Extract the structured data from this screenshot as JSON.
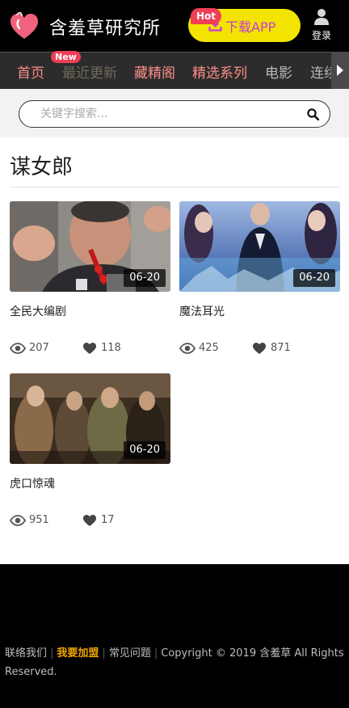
{
  "header": {
    "app_title": "含羞草研究所",
    "download_label": "下载APP",
    "hot_badge": "Hot",
    "login_label": "登录",
    "accent_color": "#f2e400"
  },
  "nav": {
    "new_badge": "New",
    "items": [
      {
        "label": "首页"
      },
      {
        "label": "最近更新"
      },
      {
        "label": "藏精阁"
      },
      {
        "label": "精选系列"
      },
      {
        "label": "电影"
      },
      {
        "label": "连续"
      }
    ]
  },
  "search": {
    "placeholder": "关键字搜索..."
  },
  "section": {
    "title": "谋女郎"
  },
  "videos": [
    {
      "title": "全民大编剧",
      "date": "06-20",
      "views": "207",
      "likes": "118"
    },
    {
      "title": "魔法耳光",
      "date": "06-20",
      "views": "425",
      "likes": "871"
    },
    {
      "title": "虎口惊魂",
      "date": "06-20",
      "views": "951",
      "likes": "17"
    }
  ],
  "footer": {
    "contact": "联络我们",
    "join": "我要加盟",
    "faq": "常见问题",
    "copyright": "Copyright © 2019 含羞草 All Rights Reserved."
  }
}
